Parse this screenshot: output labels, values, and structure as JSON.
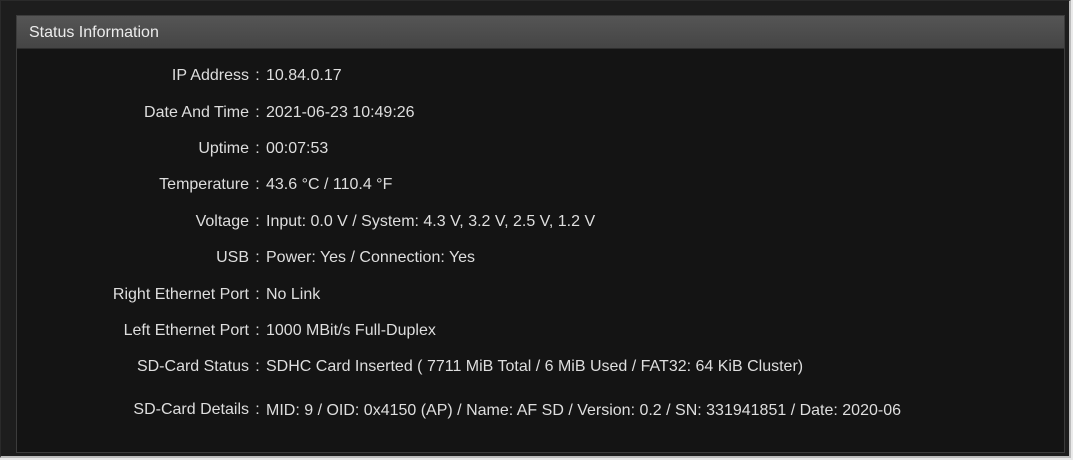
{
  "panel": {
    "title": "Status Information"
  },
  "rows": [
    {
      "label": "IP Address",
      "sep": ":",
      "value": "10.84.0.17"
    },
    {
      "label": "Date And Time",
      "sep": ":",
      "value": "2021-06-23 10:49:26"
    },
    {
      "label": "Uptime",
      "sep": ":",
      "value": "00:07:53"
    },
    {
      "label": "Temperature",
      "sep": ":",
      "value": "43.6 °C / 110.4 °F"
    },
    {
      "label": "Voltage",
      "sep": ":",
      "value": "Input: 0.0 V / System: 4.3 V, 3.2 V, 2.5 V, 1.2 V"
    },
    {
      "label": "USB",
      "sep": ":",
      "value": "Power: Yes / Connection: Yes"
    },
    {
      "label": "Right Ethernet Port",
      "sep": ":",
      "value": "No Link"
    },
    {
      "label": "Left Ethernet Port",
      "sep": ":",
      "value": "1000 MBit/s Full-Duplex"
    },
    {
      "label": "SD-Card Status",
      "sep": ":",
      "value": "SDHC Card Inserted ( 7711 MiB Total / 6 MiB Used / FAT32: 64 KiB Cluster)"
    },
    {
      "label": "SD-Card Details",
      "sep": ":",
      "value": "MID: 9 / OID: 0x4150 (AP) / Name: AF SD / Version: 0.2 / SN: 331941851 / Date: 2020-06"
    }
  ]
}
